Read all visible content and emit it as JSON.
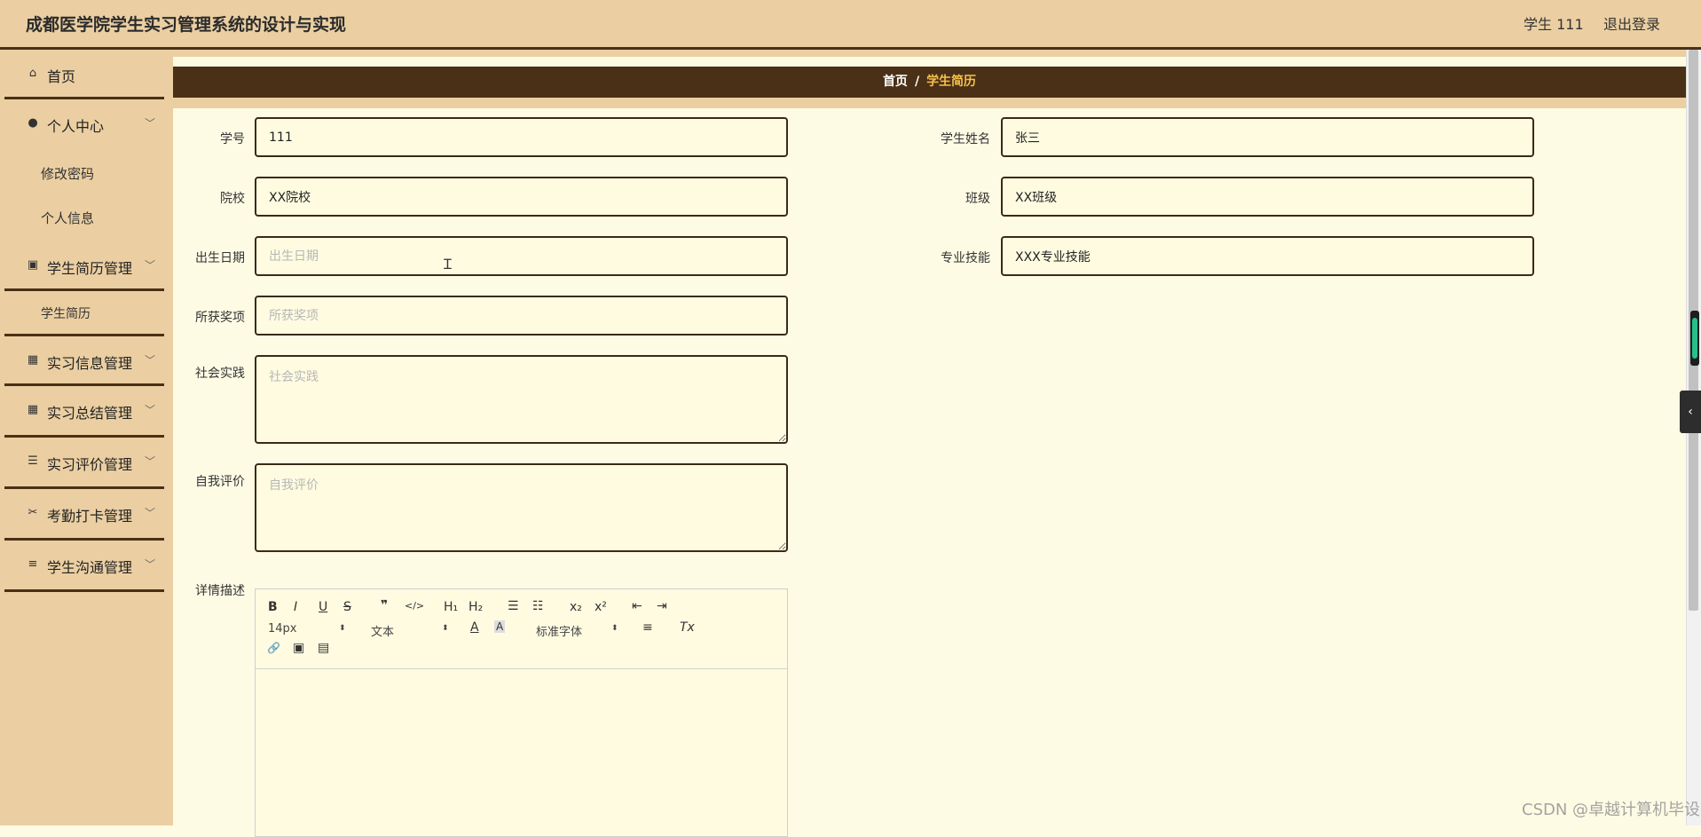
{
  "header": {
    "title": "成都医学院学生实习管理系统的设计与实现",
    "user": "学生 111",
    "logout": "退出登录"
  },
  "sidebar": {
    "items": [
      {
        "label": "首页",
        "icon": "home-icon"
      },
      {
        "label": "个人中心",
        "icon": "user-icon"
      },
      {
        "label": "学生简历管理",
        "icon": "clipboard-icon"
      },
      {
        "label": "实习信息管理",
        "icon": "grid-icon"
      },
      {
        "label": "实习总结管理",
        "icon": "grid-icon"
      },
      {
        "label": "实习评价管理",
        "icon": "sliders-icon"
      },
      {
        "label": "考勤打卡管理",
        "icon": "ticket-icon"
      },
      {
        "label": "学生沟通管理",
        "icon": "list-icon"
      }
    ],
    "personal_sub": [
      "修改密码",
      "个人信息"
    ],
    "resume_sub": [
      "学生简历"
    ]
  },
  "breadcrumb": {
    "home": "首页",
    "separator": "/",
    "current": "学生简历"
  },
  "form": {
    "student_no": {
      "label": "学号",
      "value": "111"
    },
    "student_name": {
      "label": "学生姓名",
      "value": "张三"
    },
    "school": {
      "label": "院校",
      "value": "XX院校"
    },
    "class": {
      "label": "班级",
      "value": "XX班级"
    },
    "birth_date": {
      "label": "出生日期",
      "placeholder": "出生日期"
    },
    "skills": {
      "label": "专业技能",
      "value": "XXX专业技能"
    },
    "awards": {
      "label": "所获奖项",
      "placeholder": "所获奖项"
    },
    "social": {
      "label": "社会实践",
      "placeholder": "社会实践"
    },
    "self_eval": {
      "label": "自我评价",
      "placeholder": "自我评价"
    },
    "details": {
      "label": "详情描述"
    }
  },
  "editor": {
    "bold": "B",
    "italic": "I",
    "underline": "U",
    "strike": "S",
    "quote": "❞",
    "code": "</>",
    "h1": "H₁",
    "h2": "H₂",
    "ordered_list": "☰",
    "bullet_list": "☷",
    "sub": "x₂",
    "sup": "x²",
    "outdent": "⇤",
    "indent": "⇥",
    "size": "14px",
    "block": "文本",
    "color": "A",
    "background": "A",
    "font": "标准字体",
    "align": "≡",
    "clean": "Tx",
    "link": "🔗",
    "image": "▣",
    "video": "▤"
  },
  "watermark": "CSDN @卓越计算机毕设",
  "colors": {
    "header_bg": "#ebcfa2",
    "dark_brown": "#4a3016",
    "content_bg": "#fefbe4",
    "accent": "#f6c04a"
  }
}
